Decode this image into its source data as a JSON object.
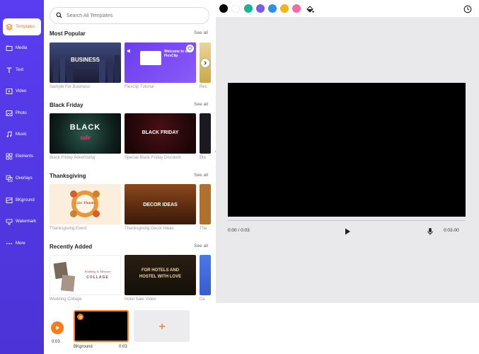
{
  "sidebar": {
    "items": [
      {
        "label": "Templates",
        "icon": "layers-icon"
      },
      {
        "label": "Media",
        "icon": "folder-icon"
      },
      {
        "label": "Text",
        "icon": "text-icon"
      },
      {
        "label": "Video",
        "icon": "video-icon"
      },
      {
        "label": "Photo",
        "icon": "image-icon"
      },
      {
        "label": "Music",
        "icon": "music-icon"
      },
      {
        "label": "Elements",
        "icon": "elements-icon"
      },
      {
        "label": "Overlays",
        "icon": "overlays-icon"
      },
      {
        "label": "BKground",
        "icon": "background-icon"
      },
      {
        "label": "Watermark",
        "icon": "watermark-icon"
      },
      {
        "label": "More",
        "icon": "more-icon"
      }
    ]
  },
  "search": {
    "placeholder": "Search All Templates"
  },
  "sections": [
    {
      "title": "Most Popular",
      "see_all": "See all",
      "templates": [
        {
          "label": "Sample For Business",
          "text": "BUSINESS"
        },
        {
          "label": "Flexclip Tutorial",
          "text": "Welcome to use FlexClip"
        },
        {
          "label": "Rec"
        }
      ]
    },
    {
      "title": "Black Friday",
      "see_all": "See all",
      "templates": [
        {
          "label": "Black Friday Advertising",
          "text": "BLACK",
          "subtext": "sale"
        },
        {
          "label": "Special Black Friday Discount",
          "text": "BLACK FRIDAY"
        },
        {
          "label": "Bla"
        }
      ]
    },
    {
      "title": "Thanksgiving",
      "see_all": "See all",
      "templates": [
        {
          "label": "Thanksgiving Event",
          "text": "Give Thanks"
        },
        {
          "label": "Thanksgiving Decor Ideas",
          "text": "DECOR IDEAS"
        },
        {
          "label": "Tha"
        }
      ]
    },
    {
      "title": "Recently Added",
      "see_all": "See all",
      "templates": [
        {
          "label": "Wedding Collage",
          "text": "Wedding & Memory",
          "subtext": "COLLAGE"
        },
        {
          "label": "Hotel Sale Video",
          "text": "FOR HOTELS AND HOSTEL WITH LOVE"
        },
        {
          "label": "Da"
        }
      ]
    }
  ],
  "toolbar": {
    "colors": [
      "#000000",
      "#ffffff",
      "#1ab394",
      "#7a5ce6",
      "#2e90e8",
      "#f5b21a",
      "#f06aa8"
    ],
    "fill_icon": "paint-bucket-icon",
    "history_icon": "clock-icon"
  },
  "player": {
    "current_time": "0:00 / 0:03",
    "total_time": "0:03.00"
  },
  "timeline": {
    "time": "0:03",
    "clip_name": "BKground",
    "clip_duration": "0:03"
  },
  "accent": "#ff7a1a",
  "sidebar_color": "#5a3df0"
}
